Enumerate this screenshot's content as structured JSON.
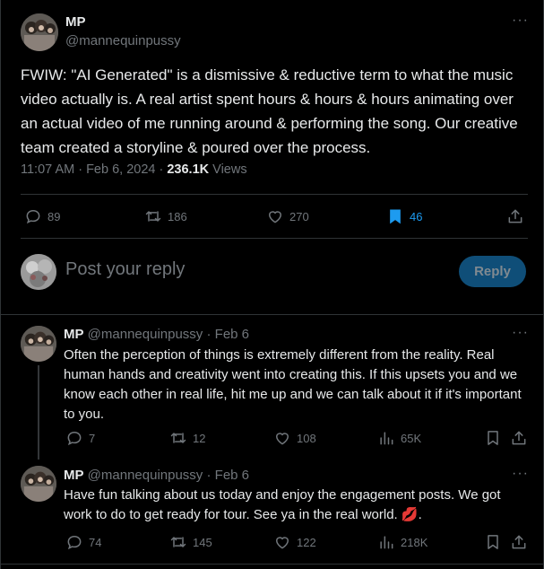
{
  "main_tweet": {
    "name": "MP",
    "handle": "@mannequinpussy",
    "text": "FWIW: \"AI Generated\" is a dismissive & reductive term to what the music video actually is. A real artist spent hours & hours & hours animating over an actual video of me running around & performing the song. Our creative team created a storyline & poured over the process.",
    "time": "11:07 AM · Feb 6, 2024 · ",
    "views_count": "236.1K",
    "views_label": " Views",
    "replies": "89",
    "retweets": "186",
    "likes": "270",
    "bookmarks": "46"
  },
  "reply_box": {
    "placeholder": "Post your reply",
    "button": "Reply"
  },
  "replies": [
    {
      "name": "MP",
      "handle": "@mannequinpussy",
      "sep": " · ",
      "date": "Feb 6",
      "text": "Often the perception of things is extremely different from the reality. Real human hands and creativity went into creating this. If this upsets you and we know each other in real life, hit me up and we can talk about it if it's important to you.",
      "replies": "7",
      "retweets": "12",
      "likes": "108",
      "views": "65K"
    },
    {
      "name": "MP",
      "handle": "@mannequinpussy",
      "sep": " · ",
      "date": "Feb 6",
      "text": "Have fun talking about us today and enjoy the engagement posts. We got work to do to get ready for tour. See ya in the real world. ",
      "emoji": "💋",
      "text_end": ".",
      "replies": "74",
      "retweets": "145",
      "likes": "122",
      "views": "218K"
    }
  ],
  "colors": {
    "background": "#000000",
    "text": "#e7e9ea",
    "muted": "#71767b",
    "accent": "#1d9bf0",
    "divider": "#2f3336"
  }
}
